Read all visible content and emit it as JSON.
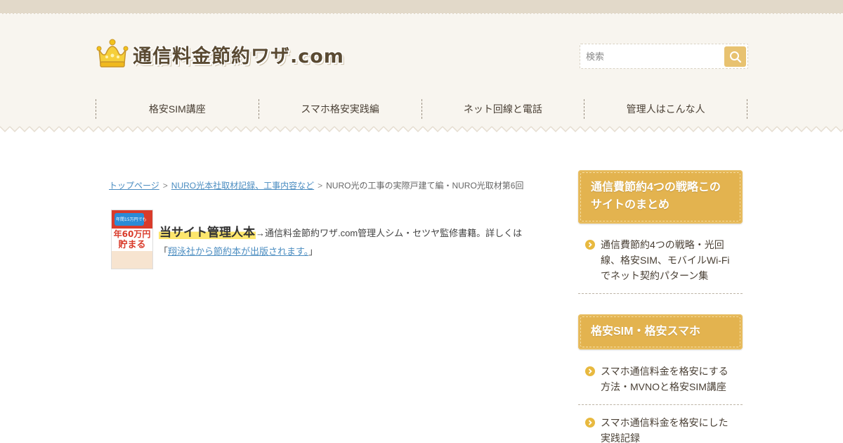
{
  "site": {
    "logo_text": "通信料金節約ワザ.com",
    "logo_icon": "crown-icon"
  },
  "search": {
    "placeholder": "検索",
    "button_icon": "search-icon"
  },
  "nav": {
    "items": [
      {
        "label": "格安SIM講座"
      },
      {
        "label": "スマホ格安実践編"
      },
      {
        "label": "ネット回線と電話"
      },
      {
        "label": "管理人はこんな人"
      }
    ]
  },
  "breadcrumb": {
    "home": "トップページ",
    "category": "NURO光本社取材記録、工事内容など",
    "current": "NURO光の工事の実際戸建て編・NURO光取材第6回",
    "separator": ">"
  },
  "promo": {
    "book_cover_top": "年間15万円でも",
    "book_cover_title": "年60万円",
    "book_cover_title2": "貯まる",
    "highlight": "当サイト管理人本",
    "arrow": "→",
    "text": "通信料金節約ワザ.com管理人シム・セツヤ監修書籍。詳しくは",
    "open_quote": "「",
    "link": "翔泳社から節約本が出版されます。",
    "close_quote": "」"
  },
  "sidebar": {
    "sections": [
      {
        "title": "通信費節約4つの戦略このサイトのまとめ",
        "links": [
          {
            "label": "通信費節約4つの戦略・光回線、格安SIM、モバイルWi-Fiでネット契約パターン集"
          }
        ]
      },
      {
        "title": "格安SIM・格安スマホ",
        "links": [
          {
            "label": "スマホ通信料金を格安にする方法・MVNOと格安SIM講座"
          },
          {
            "label": "スマホ通信料金を格安にした実践記録"
          }
        ]
      }
    ]
  },
  "colors": {
    "accent": "#e3b34f",
    "header_bg": "#f8f5ef",
    "top_strip": "#e2d9c9",
    "link": "#4a8cc0",
    "highlight": "#fde66d"
  }
}
